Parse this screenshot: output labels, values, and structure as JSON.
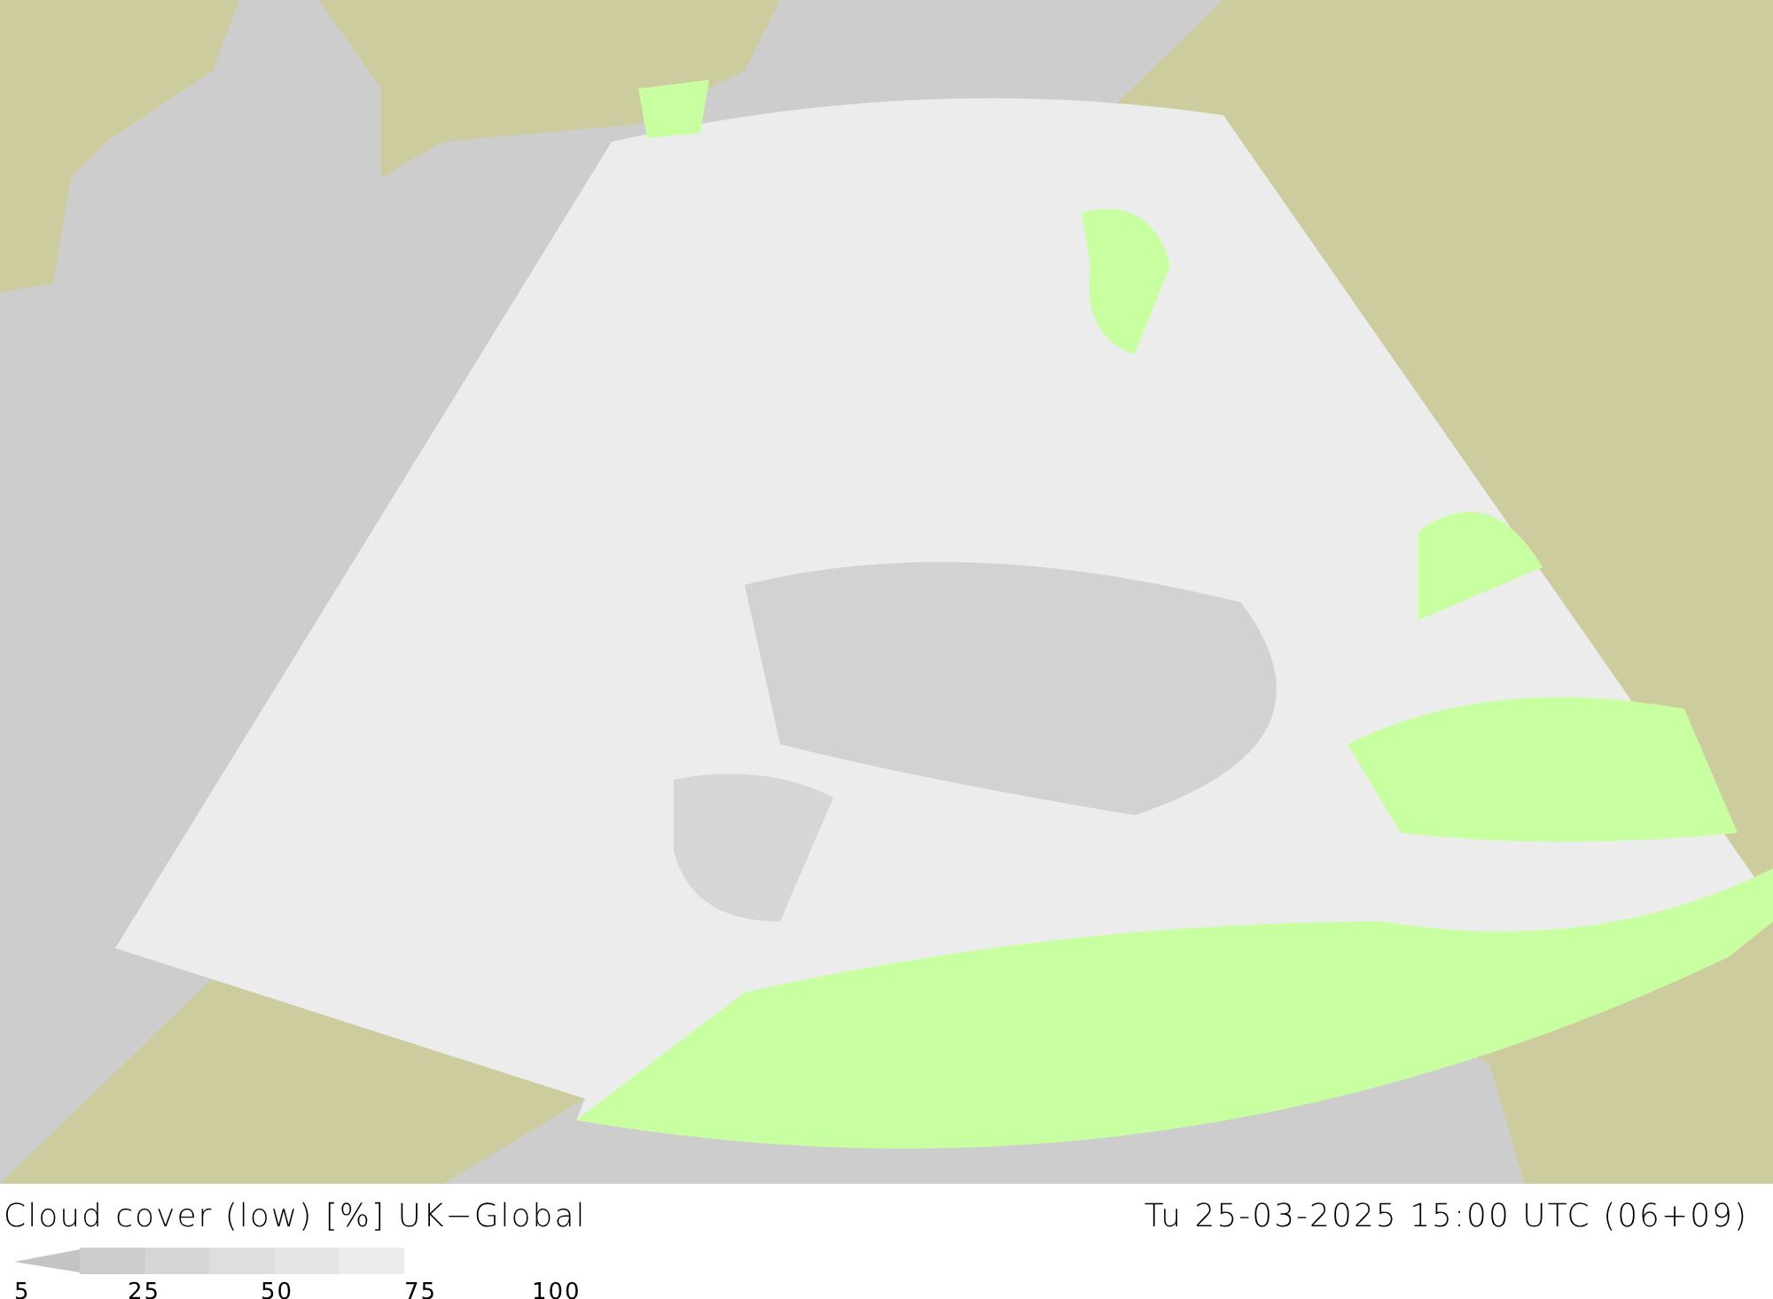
{
  "title": "Cloud cover (low) [%] UK−Global",
  "timestamp": "Tu 25-03-2025 15:00 UTC (06+09)",
  "legend": {
    "segments": [
      {
        "color": "#c4c4c4"
      },
      {
        "color": "#cdcdcd"
      },
      {
        "color": "#d6d6d6"
      },
      {
        "color": "#dedede"
      },
      {
        "color": "#e5e5e5"
      },
      {
        "color": "#ececec"
      }
    ],
    "labels": [
      "5",
      "25",
      "50",
      "75",
      "100"
    ]
  }
}
